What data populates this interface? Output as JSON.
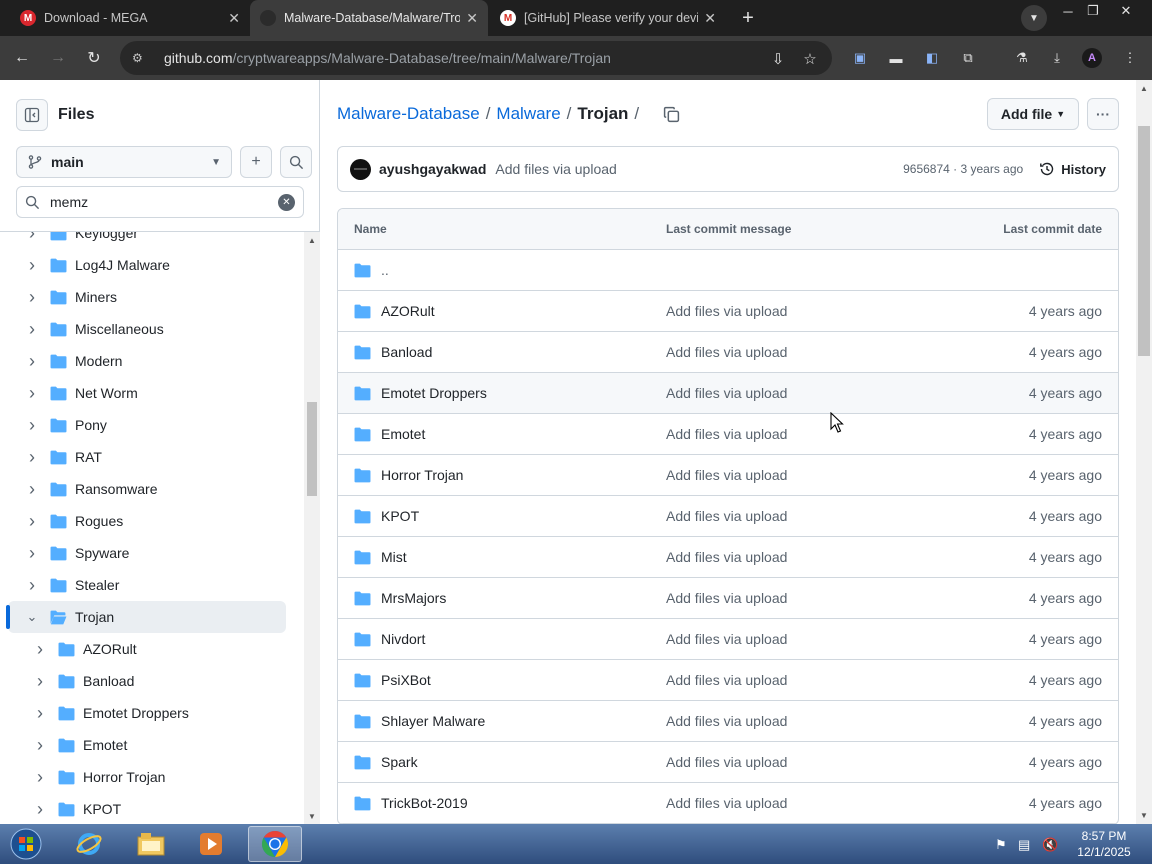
{
  "browser": {
    "tabs": [
      {
        "title": "Download - MEGA",
        "favicon": "M",
        "favicon_color": "#d9272e",
        "active": false
      },
      {
        "title": "Malware-Database/Malware/Trojan",
        "favicon": "",
        "favicon_color": "#2b2b2b",
        "active": true
      },
      {
        "title": "[GitHub] Please verify your device",
        "favicon": "M",
        "favicon_color": "#ffffff",
        "active": false
      }
    ],
    "url_host": "github.com",
    "url_path": "/cryptwareapps/Malware-Database/tree/main/Malware/Trojan"
  },
  "sidebar": {
    "title": "Files",
    "branch": "main",
    "filter_value": "memz",
    "tree": [
      {
        "label": "Keylogger",
        "level": 0,
        "expanded": false,
        "selected": false
      },
      {
        "label": "Log4J Malware",
        "level": 0,
        "expanded": false,
        "selected": false
      },
      {
        "label": "Miners",
        "level": 0,
        "expanded": false,
        "selected": false
      },
      {
        "label": "Miscellaneous",
        "level": 0,
        "expanded": false,
        "selected": false
      },
      {
        "label": "Modern",
        "level": 0,
        "expanded": false,
        "selected": false
      },
      {
        "label": "Net Worm",
        "level": 0,
        "expanded": false,
        "selected": false
      },
      {
        "label": "Pony",
        "level": 0,
        "expanded": false,
        "selected": false
      },
      {
        "label": "RAT",
        "level": 0,
        "expanded": false,
        "selected": false
      },
      {
        "label": "Ransomware",
        "level": 0,
        "expanded": false,
        "selected": false
      },
      {
        "label": "Rogues",
        "level": 0,
        "expanded": false,
        "selected": false
      },
      {
        "label": "Spyware",
        "level": 0,
        "expanded": false,
        "selected": false
      },
      {
        "label": "Stealer",
        "level": 0,
        "expanded": false,
        "selected": false
      },
      {
        "label": "Trojan",
        "level": 0,
        "expanded": true,
        "selected": true
      },
      {
        "label": "AZORult",
        "level": 1,
        "expanded": false,
        "selected": false
      },
      {
        "label": "Banload",
        "level": 1,
        "expanded": false,
        "selected": false
      },
      {
        "label": "Emotet Droppers",
        "level": 1,
        "expanded": false,
        "selected": false
      },
      {
        "label": "Emotet",
        "level": 1,
        "expanded": false,
        "selected": false
      },
      {
        "label": "Horror Trojan",
        "level": 1,
        "expanded": false,
        "selected": false
      },
      {
        "label": "KPOT",
        "level": 1,
        "expanded": false,
        "selected": false
      }
    ]
  },
  "breadcrumb": {
    "repo": "Malware-Database",
    "folder": "Malware",
    "current": "Trojan",
    "sep": "/"
  },
  "toolbar": {
    "add_file": "Add file"
  },
  "commit": {
    "author": "ayushgayakwad",
    "message": "Add files via upload",
    "meta": "9656874 · 3 years ago",
    "history": "History"
  },
  "table": {
    "headers": [
      "Name",
      "Last commit message",
      "Last commit date"
    ],
    "parent": "..",
    "rows": [
      {
        "name": "AZORult",
        "message": "Add files via upload",
        "date": "4 years ago"
      },
      {
        "name": "Banload",
        "message": "Add files via upload",
        "date": "4 years ago"
      },
      {
        "name": "Emotet Droppers",
        "message": "Add files via upload",
        "date": "4 years ago"
      },
      {
        "name": "Emotet",
        "message": "Add files via upload",
        "date": "4 years ago"
      },
      {
        "name": "Horror Trojan",
        "message": "Add files via upload",
        "date": "4 years ago"
      },
      {
        "name": "KPOT",
        "message": "Add files via upload",
        "date": "4 years ago"
      },
      {
        "name": "Mist",
        "message": "Add files via upload",
        "date": "4 years ago"
      },
      {
        "name": "MrsMajors",
        "message": "Add files via upload",
        "date": "4 years ago"
      },
      {
        "name": "Nivdort",
        "message": "Add files via upload",
        "date": "4 years ago"
      },
      {
        "name": "PsiXBot",
        "message": "Add files via upload",
        "date": "4 years ago"
      },
      {
        "name": "Shlayer Malware",
        "message": "Add files via upload",
        "date": "4 years ago"
      },
      {
        "name": "Spark",
        "message": "Add files via upload",
        "date": "4 years ago"
      },
      {
        "name": "TrickBot-2019",
        "message": "Add files via upload",
        "date": "4 years ago"
      }
    ],
    "hover_row": "Emotet Droppers"
  },
  "colors": {
    "folder": "#54aeff",
    "link": "#0969da",
    "selected_bar": "#0969da"
  },
  "taskbar": {
    "time": "8:57 PM",
    "date": "12/1/2025",
    "items": [
      "start-orb",
      "internet-explorer",
      "file-explorer",
      "media-player",
      "chrome"
    ]
  }
}
